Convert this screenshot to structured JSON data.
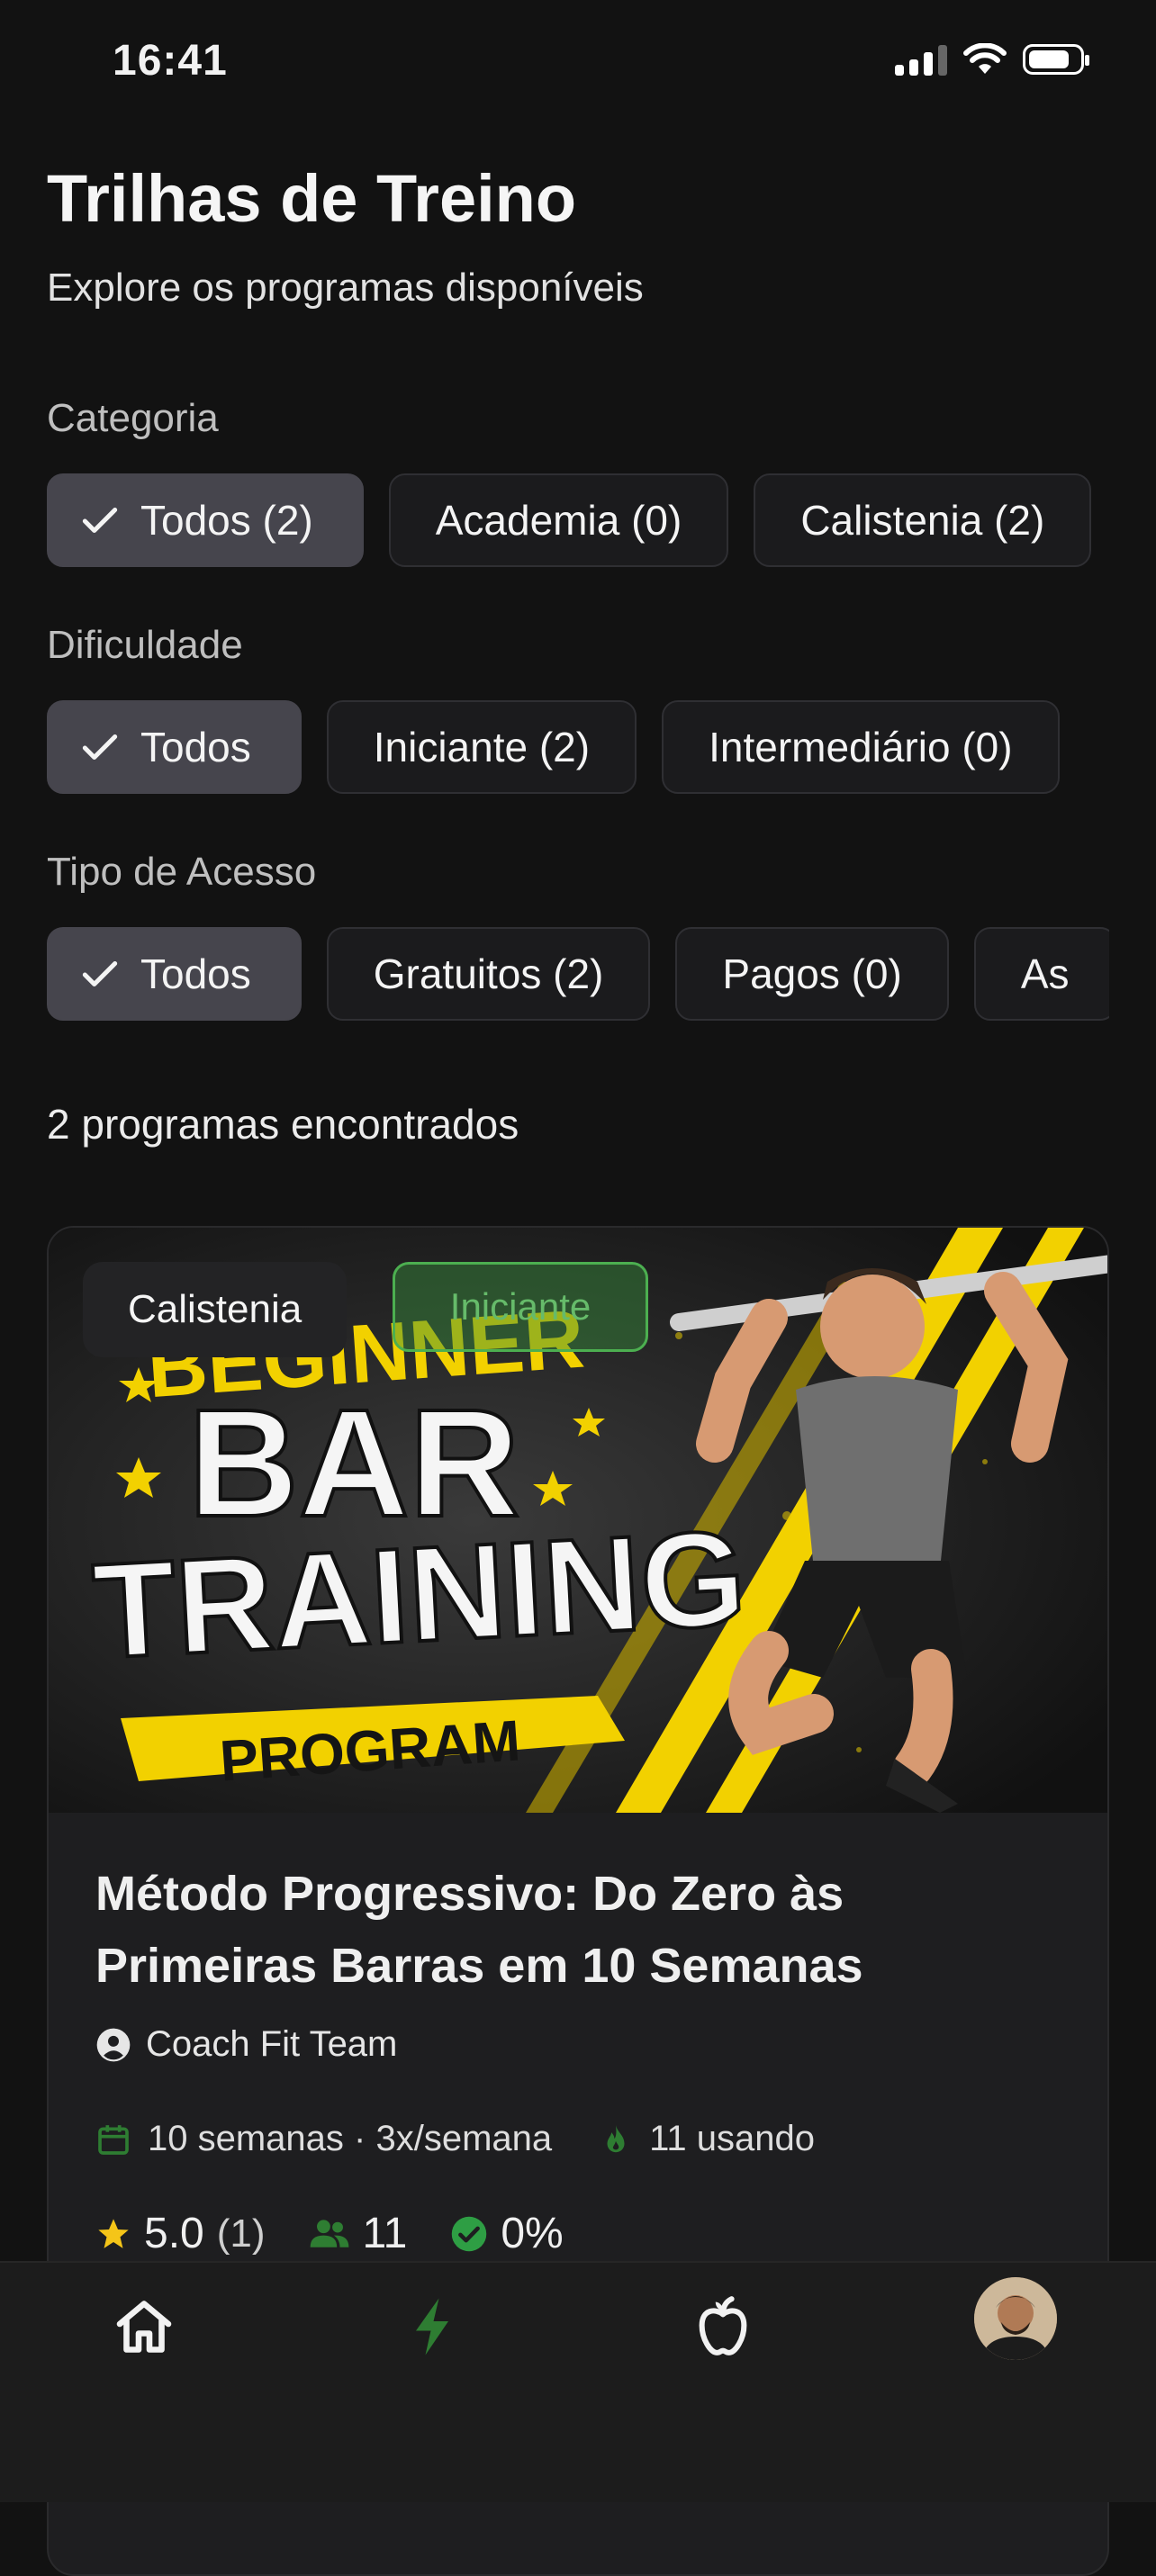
{
  "status_bar": {
    "time": "16:41",
    "battery_level": 0.78
  },
  "header": {
    "title": "Trilhas de Treino",
    "subtitle": "Explore os programas disponíveis"
  },
  "filters": {
    "categoria": {
      "label": "Categoria",
      "options": [
        "Todos (2)",
        "Academia (0)",
        "Calistenia (2)"
      ],
      "selected_index": 0
    },
    "dificuldade": {
      "label": "Dificuldade",
      "options": [
        "Todos",
        "Iniciante (2)",
        "Intermediário (0)"
      ],
      "selected_index": 0
    },
    "acesso": {
      "label": "Tipo de Acesso",
      "options": [
        "Todos",
        "Gratuitos (2)",
        "Pagos (0)",
        "As"
      ],
      "selected_index": 0
    }
  },
  "results": {
    "count_text": "2 programas encontrados"
  },
  "program_card": {
    "category_badge": "Calistenia",
    "level_badge": "Iniciante",
    "banner": {
      "line1": "BEGINNER",
      "line2": "BAR",
      "line3": "TRAINING",
      "line4": "PROGRAM"
    },
    "title": "Método Progressivo: Do Zero às Primeiras Barras em 10 Semanas",
    "coach": "Coach Fit Team",
    "duration": "10 semanas · 3x/semana",
    "active_users": "11 usando",
    "rating": "5.0",
    "rating_count": "(1)",
    "enrolled": "11",
    "completion": "0%"
  },
  "tabbar": {
    "items": [
      "home-icon",
      "bolt-icon",
      "apple-icon",
      "avatar"
    ],
    "active_index": 1
  },
  "colors": {
    "background": "#121212",
    "accent_green": "#2e7d32",
    "chip_selected": "#46454d",
    "star": "#f5c518"
  }
}
